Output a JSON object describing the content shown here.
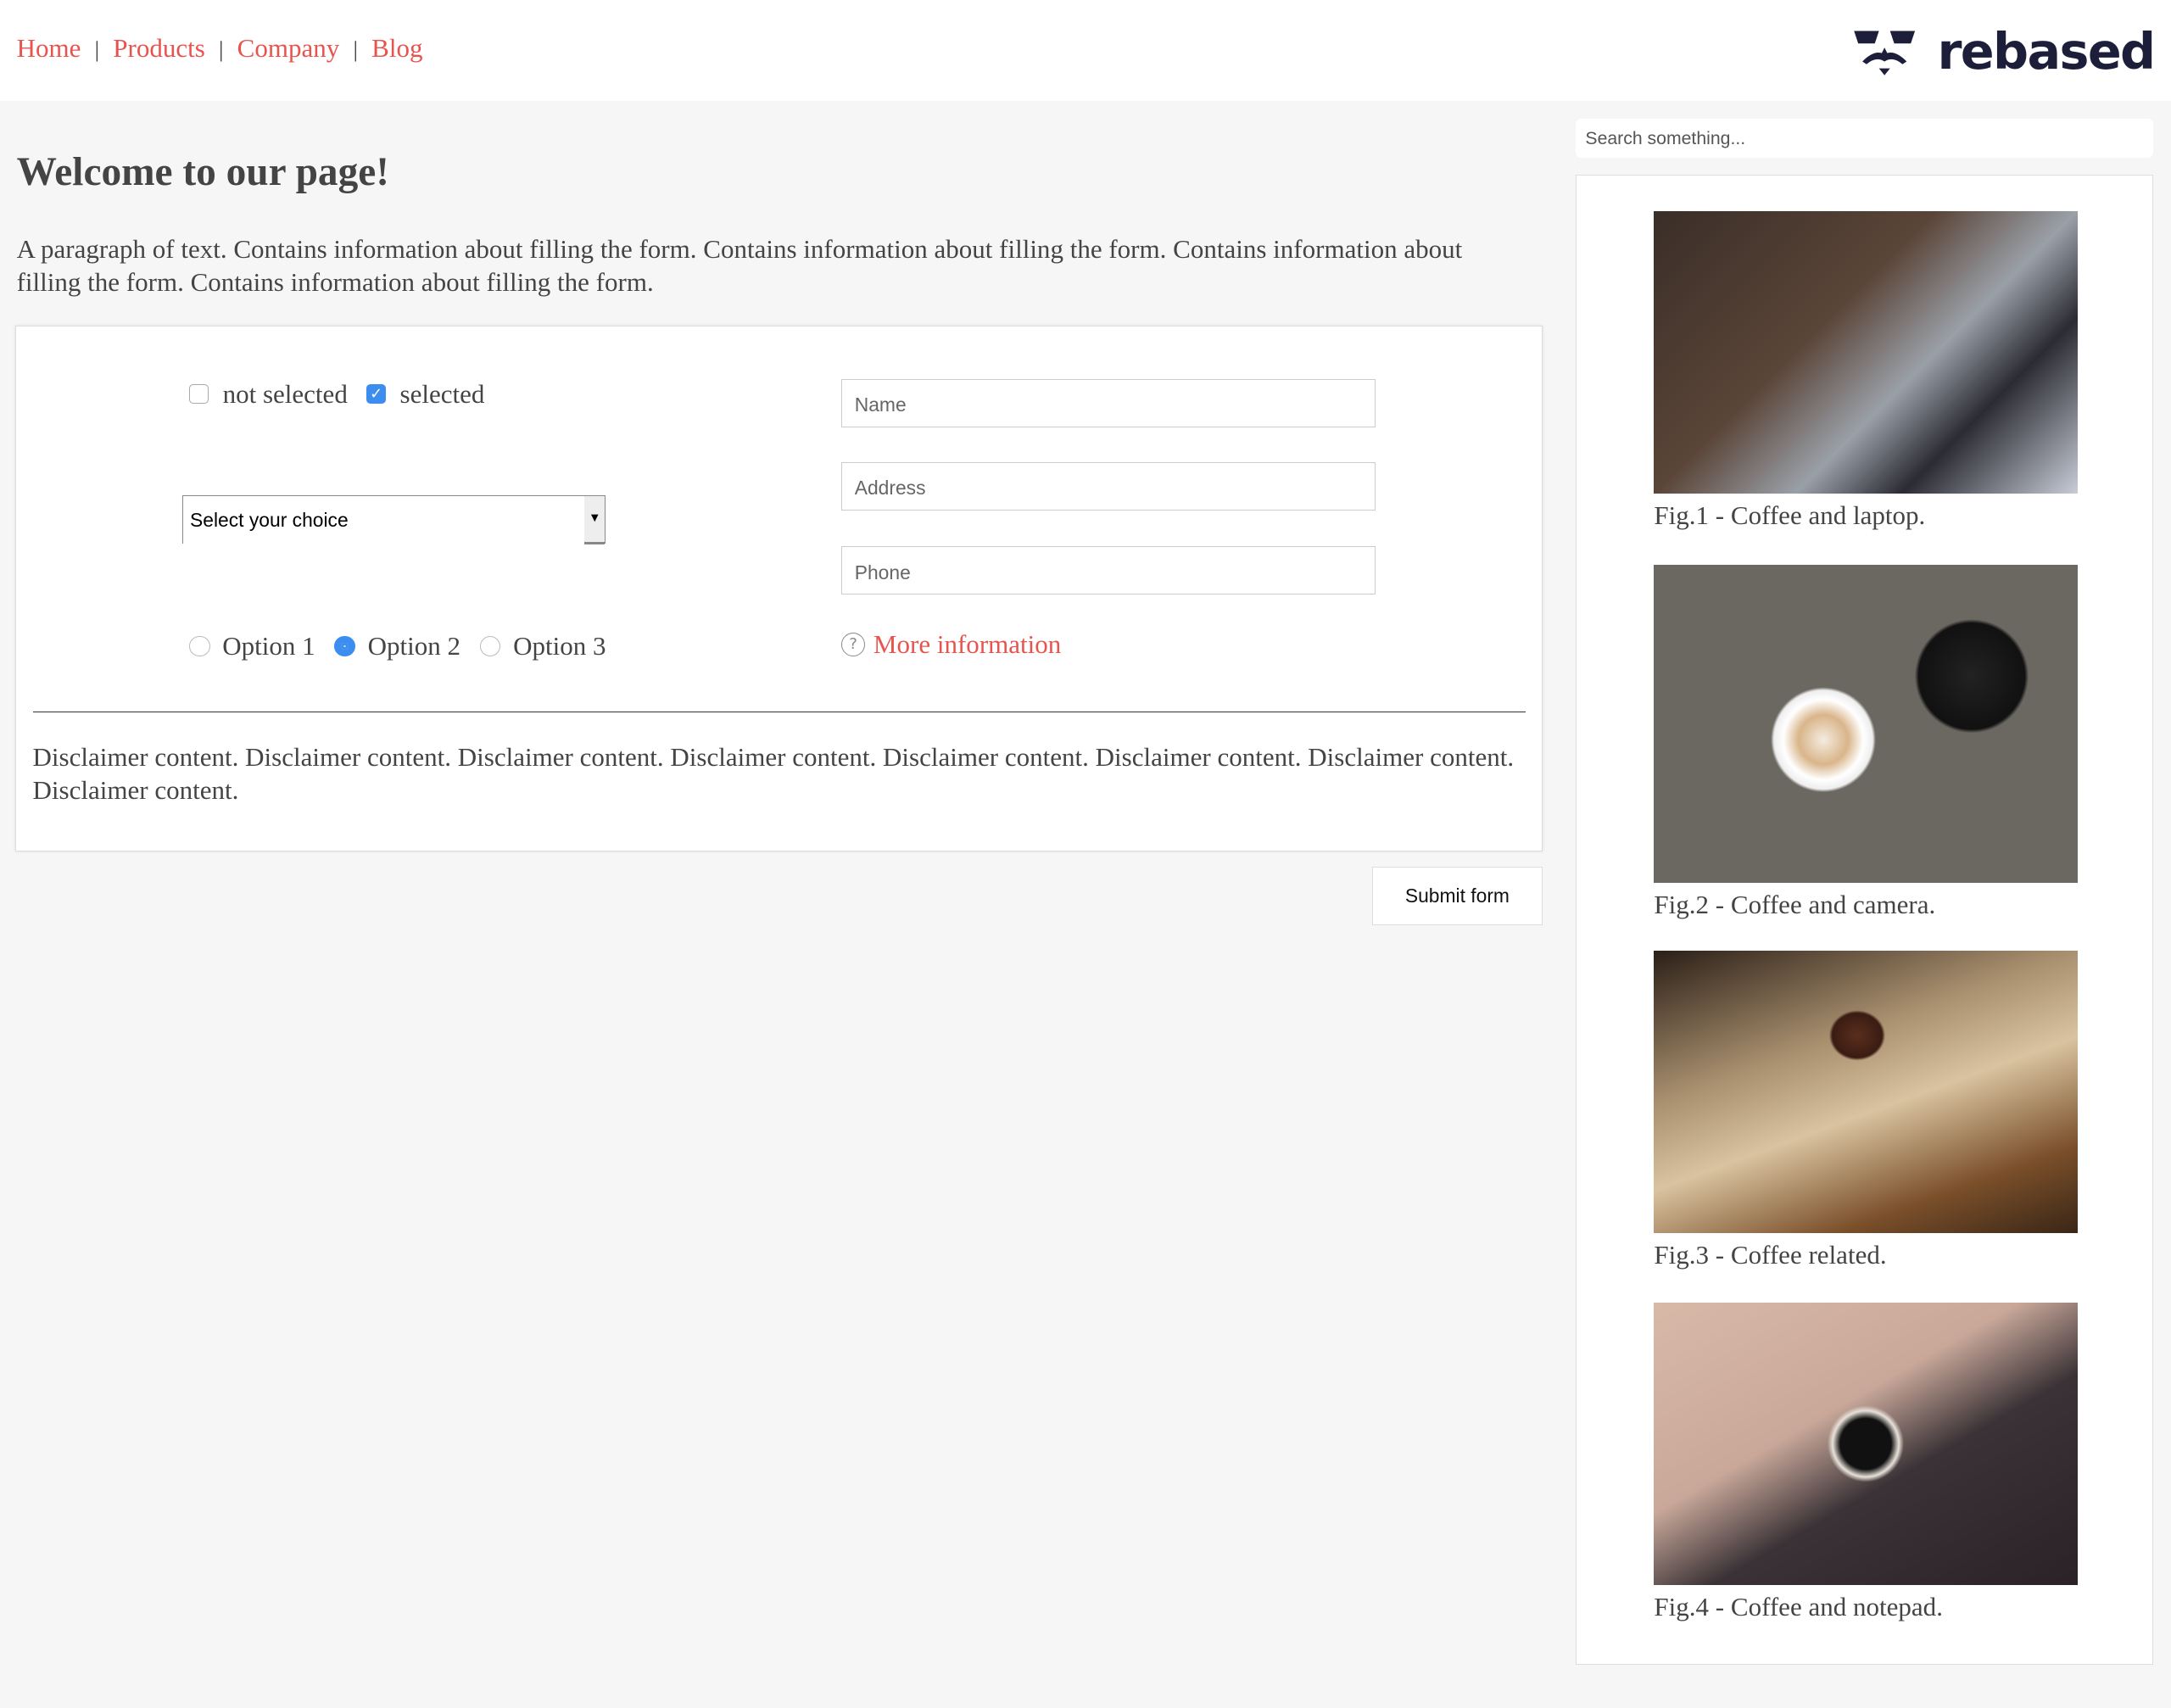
{
  "nav": {
    "items": [
      "Home",
      "Products",
      "Company",
      "Blog"
    ]
  },
  "logo": {
    "text": "rebased"
  },
  "page": {
    "title": "Welcome to our page!",
    "intro": "A paragraph of text. Contains information about filling the form. Contains information about filling the form. Contains information about filling the form. Contains information about filling the form."
  },
  "form": {
    "checkboxes": [
      {
        "label": "not selected",
        "checked": false
      },
      {
        "label": "selected",
        "checked": true
      }
    ],
    "select": {
      "value": "Select your choice"
    },
    "radios": [
      {
        "label": "Option 1",
        "checked": false
      },
      {
        "label": "Option 2",
        "checked": true
      },
      {
        "label": "Option 3",
        "checked": false
      }
    ],
    "inputs": {
      "name_placeholder": "Name",
      "address_placeholder": "Address",
      "phone_placeholder": "Phone"
    },
    "more_info": "More information",
    "disclaimer": "Disclaimer content. Disclaimer content. Disclaimer content. Disclaimer content. Disclaimer content. Disclaimer content. Disclaimer content. Disclaimer content.",
    "submit": "Submit form"
  },
  "sidebar": {
    "search_placeholder": "Search something...",
    "figures": [
      {
        "caption": "Fig.1 - Coffee and laptop."
      },
      {
        "caption": "Fig.2 - Coffee and camera."
      },
      {
        "caption": "Fig.3 - Coffee related."
      },
      {
        "caption": "Fig.4 - Coffee and notepad."
      }
    ]
  },
  "colors": {
    "accent": "#e9534d",
    "checkbox": "#3b8ef0",
    "logo": "#1d1f3a"
  }
}
